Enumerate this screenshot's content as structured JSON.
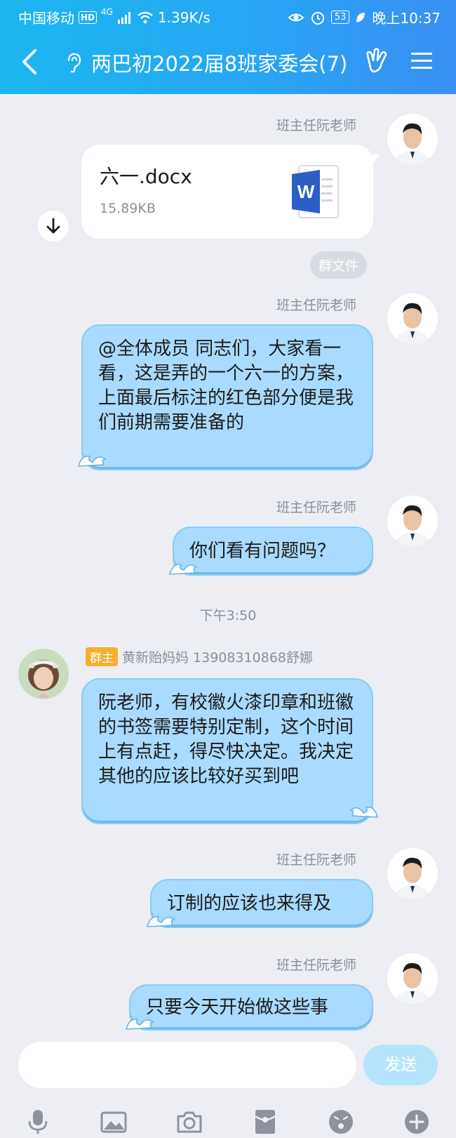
{
  "status_bar": {
    "carrier": "中国移动",
    "hd": "HD",
    "network": "4G",
    "speed": "1.39K/s",
    "battery": "53",
    "time": "晚上10:37"
  },
  "header": {
    "title": "两巴初2022届8班家委会(7)"
  },
  "messages": [
    {
      "sender": "班主任阮老师",
      "type": "file",
      "file_name": "六一.docx",
      "file_size": "15.89KB",
      "tag": "群文件"
    },
    {
      "sender": "班主任阮老师",
      "text": "@全体成员 同志们，大家看一看，这是弄的一个六一的方案，上面最后标注的红色部分便是我们前期需要准备的"
    },
    {
      "sender": "班主任阮老师",
      "text": "你们看有问题吗？"
    },
    {
      "sender_badge": "群主",
      "sender": "黄新贻妈妈 13908310868舒娜",
      "text": "阮老师，有校徽火漆印章和班徽的书签需要特别定制，这个时间上有点赶，得尽快决定。我决定其他的应该比较好买到吧"
    },
    {
      "sender": "班主任阮老师",
      "text": "订制的应该也来得及"
    },
    {
      "sender": "班主任阮老师",
      "text": "只要今天开始做这些事"
    }
  ],
  "time_separator": "下午3:50",
  "composer": {
    "placeholder": "",
    "send_label": "发送"
  },
  "icons": {
    "toolbar": [
      "microphone-icon",
      "image-icon",
      "camera-icon",
      "red-packet-icon",
      "emoji-icon",
      "plus-icon"
    ]
  },
  "colors": {
    "header": "#26a6f3",
    "bubble": "#a8dbff",
    "owner_badge": "#f8ad2b",
    "send_button": "#b4e5fb"
  }
}
